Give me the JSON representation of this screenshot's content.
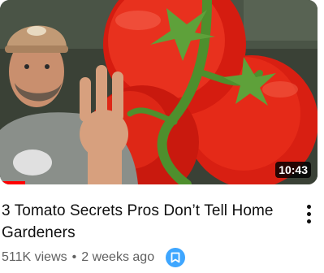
{
  "video": {
    "title": "3 Tomato Secrets Pros Don’t Tell Home Gardeners",
    "duration": "10:43",
    "views": "511K views",
    "separator": "•",
    "age": "2 weeks ago",
    "watched_fraction": 0.08
  },
  "icons": {
    "menu": "more-vert-icon",
    "badge": "bookmark-icon"
  },
  "colors": {
    "progress": "#ff0000",
    "badge": "#3ea6ff",
    "title_text": "#0f0f0f",
    "meta_text": "#606060"
  }
}
